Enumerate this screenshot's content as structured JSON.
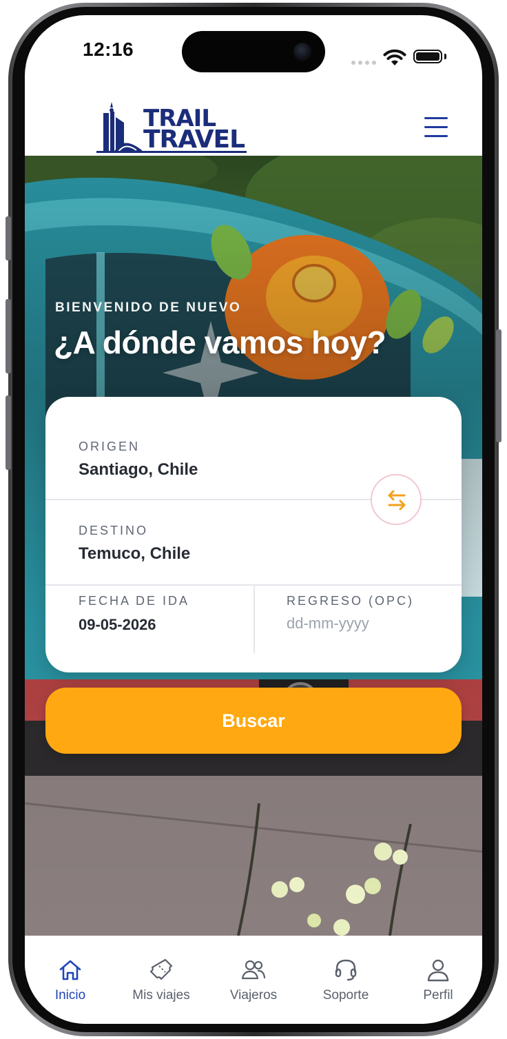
{
  "status_bar": {
    "time": "12:16"
  },
  "header": {
    "brand_line1": "TRAIL",
    "brand_line2": "TRAVEL"
  },
  "hero": {
    "welcome": "BIENVENIDO DE NUEVO",
    "headline": "¿A dónde vamos hoy?"
  },
  "search_form": {
    "origin": {
      "label": "ORIGEN",
      "value": "Santiago, Chile"
    },
    "destination": {
      "label": "DESTINO",
      "value": "Temuco, Chile"
    },
    "departure": {
      "label": "FECHA DE IDA",
      "value": "09-05-2026"
    },
    "return": {
      "label": "REGRESO (OPC)",
      "placeholder": "dd-mm-yyyy"
    },
    "search_label": "Buscar"
  },
  "tabbar": {
    "items": [
      {
        "label": "Inicio",
        "icon": "home-icon",
        "active": true
      },
      {
        "label": "Mis viajes",
        "icon": "ticket-icon",
        "active": false
      },
      {
        "label": "Viajeros",
        "icon": "users-icon",
        "active": false
      },
      {
        "label": "Soporte",
        "icon": "headset-icon",
        "active": false
      },
      {
        "label": "Perfil",
        "icon": "user-icon",
        "active": false
      }
    ]
  },
  "colors": {
    "brand_navy": "#1b2d7a",
    "accent_orange": "#ffa812",
    "active_tab": "#1f45b8",
    "swap_ring": "#f2c8cf"
  }
}
